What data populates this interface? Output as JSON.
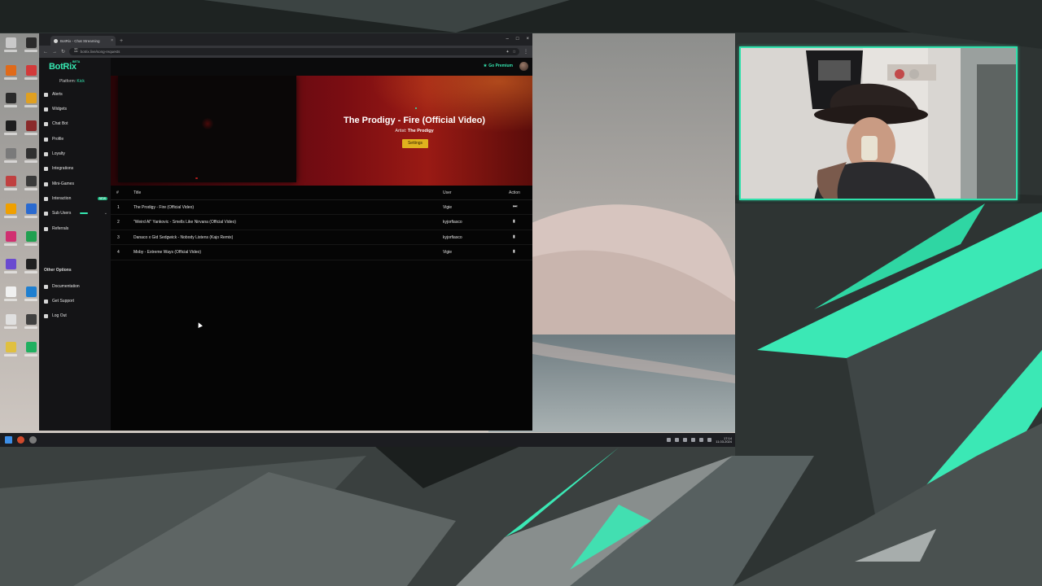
{
  "colors": {
    "accent": "#35e6b0",
    "hero_red": "#7a0d12",
    "settings_yellow": "#e0b21e",
    "overlay_green": "#2fe0ab"
  },
  "browser": {
    "tab_title": "BotRix - Chat Streaming",
    "url": "botrix.live/song-requests",
    "new_tab_icon": "+",
    "close_tab_icon": "×",
    "window_controls": [
      "–",
      "□",
      "×"
    ]
  },
  "app": {
    "logo": "BotRix",
    "logo_badge": "BETA",
    "platform_label": "Platform:",
    "platform_value": "Kick",
    "premium_label": "Go Premium",
    "sidebar": {
      "items": [
        {
          "label": "Alerts",
          "icon": "bell-icon"
        },
        {
          "label": "Widgets",
          "icon": "widget-icon"
        },
        {
          "label": "Chat Bot",
          "icon": "chat-icon"
        },
        {
          "label": "Profile",
          "icon": "user-icon"
        },
        {
          "label": "Loyalty",
          "icon": "star-icon"
        },
        {
          "label": "Integrations",
          "icon": "plug-icon"
        },
        {
          "label": "Mini-Games",
          "icon": "gamepad-icon"
        },
        {
          "label": "Interaction",
          "icon": "pointer-icon",
          "badge": "NEW"
        },
        {
          "label": "Sub Users",
          "icon": "users-icon"
        },
        {
          "label": "Referrals",
          "icon": "share-icon"
        }
      ],
      "other_options_title": "Other Options",
      "other_items": [
        {
          "label": "Documentation",
          "icon": "doc-icon"
        },
        {
          "label": "Get Support",
          "icon": "support-icon"
        },
        {
          "label": "Log Out",
          "icon": "logout-icon"
        }
      ]
    },
    "now_playing": {
      "title": "The Prodigy - Fire (Official Video)",
      "artist_label": "Artist:",
      "artist": "The Prodigy",
      "settings_button": "Settings"
    },
    "queue": {
      "headers": {
        "num": "#",
        "title": "Title",
        "user": "User",
        "action": "Action"
      },
      "rows": [
        {
          "num": "1",
          "title": "The Prodigy - Fire (Official Video)",
          "user": "Vigie",
          "action": "skip-icon"
        },
        {
          "num": "2",
          "title": "\"Weird Al\" Yankovic - Smells Like Nirvana (Official Video)",
          "user": "kyjorfiasco",
          "action": "trash-icon"
        },
        {
          "num": "3",
          "title": "Danaco x Gid Sedgwick - Nobody Listens (Kajo Remix)",
          "user": "kyjorfiasco",
          "action": "trash-icon"
        },
        {
          "num": "4",
          "title": "Moby - Extreme Ways (Official Video)",
          "user": "Vigie",
          "action": "trash-icon"
        }
      ]
    }
  },
  "taskbar": {
    "time": "17:14",
    "date": "11.03.2024"
  }
}
